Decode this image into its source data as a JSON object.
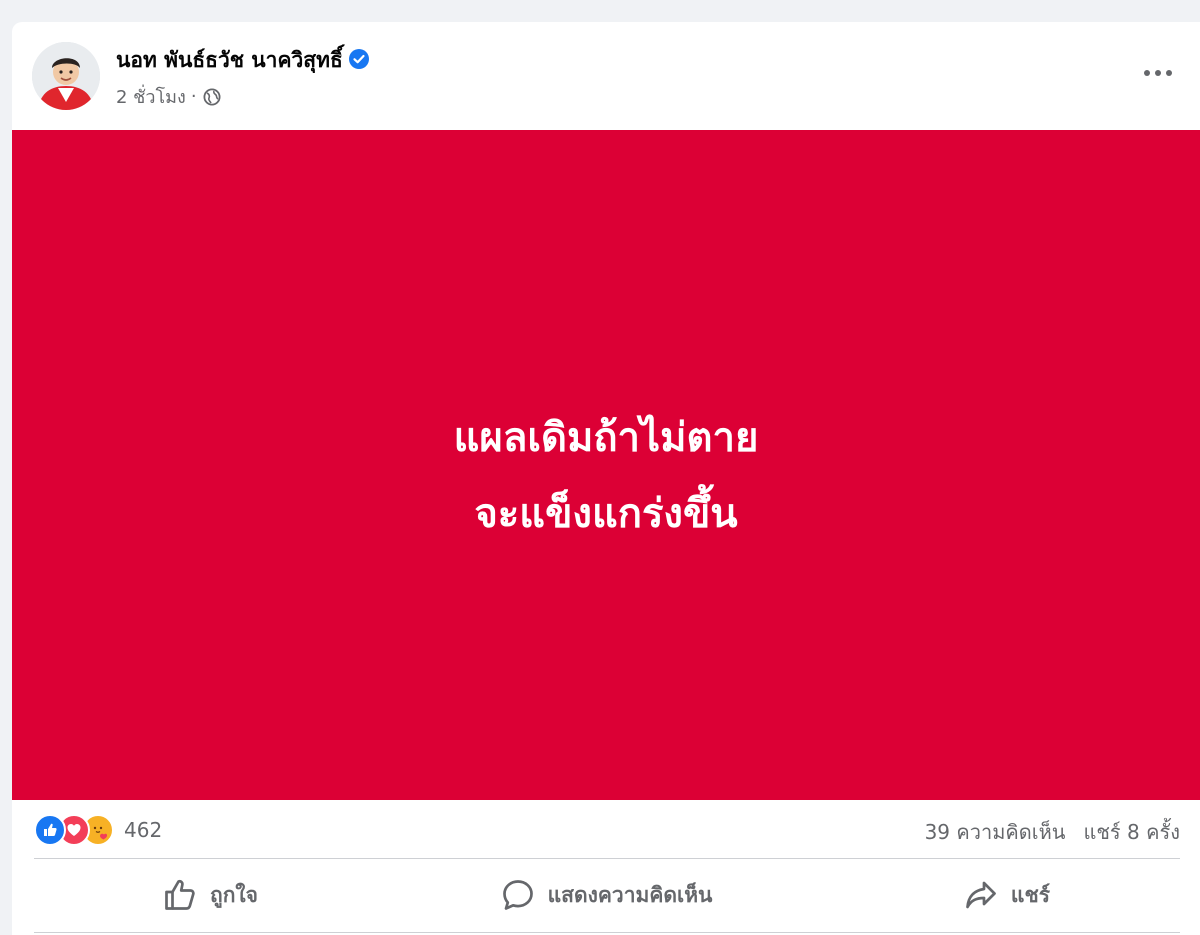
{
  "post": {
    "author": "นอท พันธ์ธวัช นาควิสุทธิ์",
    "verified": true,
    "time": "2 ชั่วโมง",
    "separator": "·",
    "audience_icon": "globe-icon",
    "more_icon": "more-horizontal-icon"
  },
  "image": {
    "background": "#dc0035",
    "line1": "แผลเดิมถ้าไม่ตาย",
    "line2": "จะแข็งแกร่งขึ้น"
  },
  "stats": {
    "reactions": [
      "like",
      "love",
      "care"
    ],
    "reaction_count": "462",
    "comments": "39 ความคิดเห็น",
    "shares": "แชร์ 8 ครั้ง"
  },
  "actions": {
    "like": "ถูกใจ",
    "comment": "แสดงความคิดเห็น",
    "share": "แชร์"
  },
  "colors": {
    "accent": "#1877f2",
    "love": "#f33e58",
    "care": "#f7b125",
    "muted_text": "#65676b"
  }
}
